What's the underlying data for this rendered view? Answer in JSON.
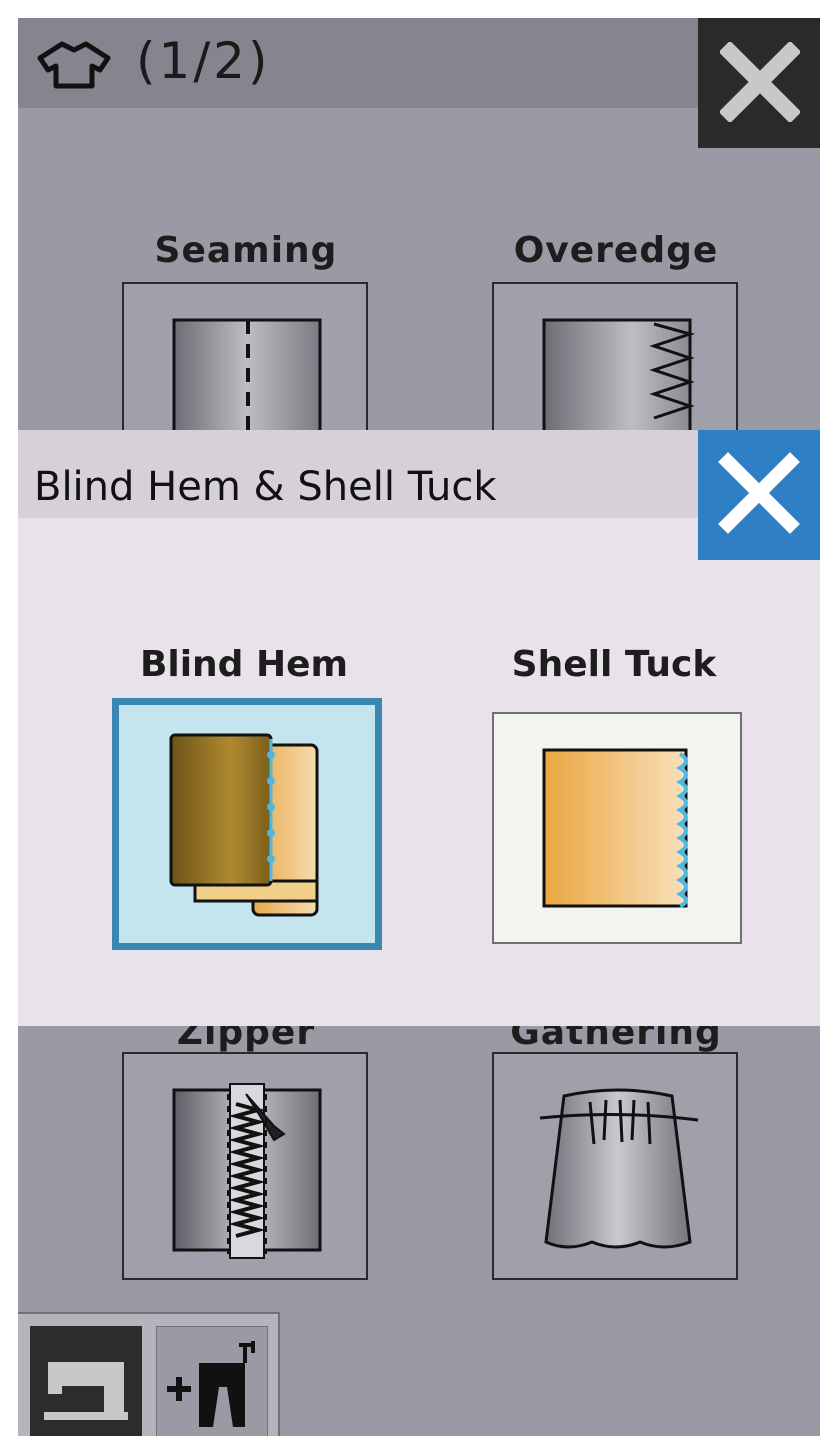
{
  "header": {
    "page_indicator": "(1/2)",
    "shirt_icon": "shirt-outline-icon",
    "close_icon": "close-icon"
  },
  "grid": {
    "tiles": [
      {
        "label": "Seaming",
        "icon": "seaming-icon"
      },
      {
        "label": "Overedge",
        "icon": "overedge-icon"
      },
      {
        "label": "Zipper",
        "icon": "zipper-icon"
      },
      {
        "label": "Gathering",
        "icon": "gathering-icon"
      }
    ]
  },
  "popup": {
    "title": "Blind Hem & Shell Tuck",
    "close_icon": "close-icon",
    "accent_color": "#2f7fc4",
    "options": [
      {
        "label": "Blind Hem",
        "icon": "blind-hem-icon",
        "selected": true
      },
      {
        "label": "Shell Tuck",
        "icon": "shell-tuck-icon",
        "selected": false
      }
    ]
  },
  "bottom_bar": {
    "buttons": [
      {
        "icon": "sewing-machine-icon",
        "active": true
      },
      {
        "icon": "add-garment-icon",
        "active": false
      }
    ]
  }
}
